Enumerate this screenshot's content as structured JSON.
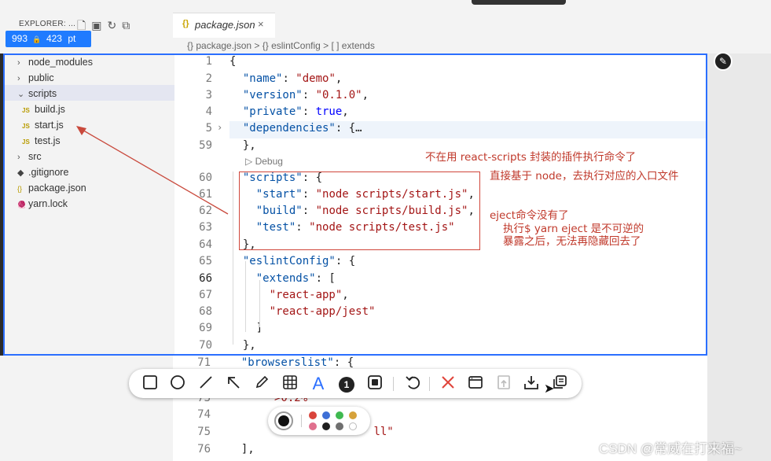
{
  "window": {
    "explorer_title": "EXPLORER: ...",
    "tab_label": "package.json",
    "tab_icon": "{}",
    "close_glyph": "×",
    "breadcrumb": "{} package.json > {} eslintConfig > [ ] extends"
  },
  "badge": {
    "width": "993",
    "height": "423",
    "unit": "pt",
    "lock_glyph": "🔒"
  },
  "explorer": {
    "items": [
      {
        "label": "node_modules",
        "kind": "folder",
        "expanded": false
      },
      {
        "label": "public",
        "kind": "folder",
        "expanded": false
      },
      {
        "label": "scripts",
        "kind": "folder",
        "expanded": true
      },
      {
        "label": "build.js",
        "kind": "js"
      },
      {
        "label": "start.js",
        "kind": "js"
      },
      {
        "label": "test.js",
        "kind": "js"
      },
      {
        "label": "src",
        "kind": "folder",
        "expanded": false
      },
      {
        "label": ".gitignore",
        "kind": "gitignore"
      },
      {
        "label": "package.json",
        "kind": "json"
      },
      {
        "label": "yarn.lock",
        "kind": "yarn"
      }
    ]
  },
  "editor": {
    "debug_lens": "▷ Debug",
    "lines": [
      {
        "n": "1",
        "html": "<span class='p'>{</span>"
      },
      {
        "n": "2",
        "html": "  <span class='k'>\"name\"</span>: <span class='s'>\"demo\"</span>,"
      },
      {
        "n": "3",
        "html": "  <span class='k'>\"version\"</span>: <span class='s'>\"0.1.0\"</span>,"
      },
      {
        "n": "4",
        "html": "  <span class='k'>\"private\"</span>: <span class='b'>true</span>,"
      },
      {
        "n": "5",
        "html": "  <span class='k'>\"dependencies\"</span>: <span class='p'>{</span>…"
      },
      {
        "n": "59",
        "html": "  },"
      },
      {
        "n": "60",
        "html": "  <span class='k'>\"scripts\"</span>: {"
      },
      {
        "n": "61",
        "html": "    <span class='k'>\"start\"</span>: <span class='s'>\"node scripts/start.js\"</span>,"
      },
      {
        "n": "62",
        "html": "    <span class='k'>\"build\"</span>: <span class='s'>\"node scripts/build.js\"</span>,"
      },
      {
        "n": "63",
        "html": "    <span class='k'>\"test\"</span>: <span class='s'>\"node scripts/test.js\"</span>"
      },
      {
        "n": "64",
        "html": "  },"
      },
      {
        "n": "65",
        "html": "  <span class='k'>\"eslintConfig\"</span>: {"
      },
      {
        "n": "66",
        "html": "    <span class='k'>\"extends\"</span>: ["
      },
      {
        "n": "67",
        "html": "      <span class='s'>\"react-app\"</span>,"
      },
      {
        "n": "68",
        "html": "      <span class='s'>\"react-app/jest\"</span>"
      },
      {
        "n": "69",
        "html": "    ]"
      },
      {
        "n": "70",
        "html": "  },"
      }
    ],
    "below_lines": [
      {
        "n": "71",
        "html": "  <span class='k'>\"browserslist\"</span>: {"
      },
      {
        "n": "73",
        "html": "      <span class='s'>\">0.2%</span>"
      },
      {
        "n": "74",
        "html": ""
      },
      {
        "n": "75",
        "html": "                      <span class='s'>ll\"</span>"
      },
      {
        "n": "76",
        "html": "  ],"
      }
    ]
  },
  "annotations": {
    "note1": "不在用 react-scripts 封装的插件执行命令了",
    "note2": "直接基于 node，去执行对应的入口文件",
    "note3": "eject命令没有了",
    "note4": "执行$ yarn eject 是不可逆的",
    "note5": "暴露之后，无法再隐藏回去了"
  },
  "toolbar": {
    "tools": [
      "rectangle-tool",
      "ellipse-tool",
      "line-tool",
      "arrow-tool",
      "pen-tool",
      "mosaic-tool",
      "text-tool",
      "number-tool",
      "highlight-tool",
      "undo-tool",
      "cancel-tool",
      "pin-tool",
      "upload-tool",
      "save-tool",
      "copy-tool"
    ],
    "number_label": "1",
    "text_label": "A"
  },
  "colors": {
    "accent": "#2b6fff",
    "annotation_red": "#c0392b",
    "palette": [
      "#d9443b",
      "#3d6fd6",
      "#3fb950",
      "#d6a23a",
      "#e0708e",
      "#1f1f1f",
      "#6f6f6f",
      "#ffffff"
    ]
  },
  "watermark": "CSDN @常威在打来福~"
}
